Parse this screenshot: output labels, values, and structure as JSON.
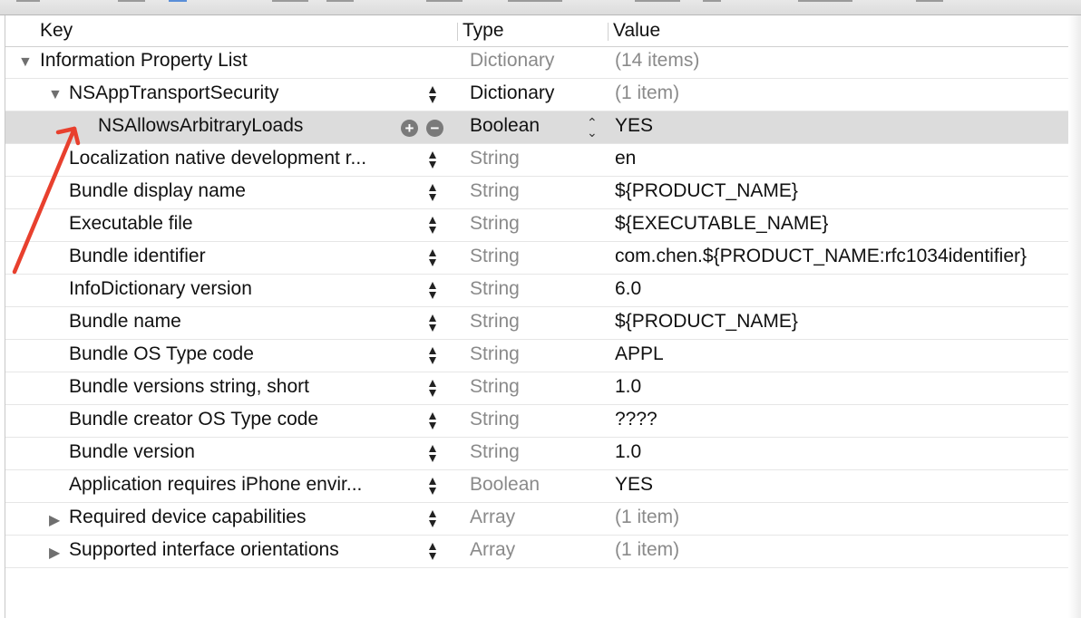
{
  "columns": {
    "key": "Key",
    "type": "Type",
    "value": "Value"
  },
  "rows": [
    {
      "key": "Information Property List",
      "type": "Dictionary",
      "value": "(14 items)"
    },
    {
      "key": "NSAppTransportSecurity",
      "type": "Dictionary",
      "value": "(1 item)"
    },
    {
      "key": "NSAllowsArbitraryLoads",
      "type": "Boolean",
      "value": "YES"
    },
    {
      "key": "Localization native development r...",
      "type": "String",
      "value": "en"
    },
    {
      "key": "Bundle display name",
      "type": "String",
      "value": "${PRODUCT_NAME}"
    },
    {
      "key": "Executable file",
      "type": "String",
      "value": "${EXECUTABLE_NAME}"
    },
    {
      "key": "Bundle identifier",
      "type": "String",
      "value": "com.chen.${PRODUCT_NAME:rfc1034identifier}"
    },
    {
      "key": "InfoDictionary version",
      "type": "String",
      "value": "6.0"
    },
    {
      "key": "Bundle name",
      "type": "String",
      "value": "${PRODUCT_NAME}"
    },
    {
      "key": "Bundle OS Type code",
      "type": "String",
      "value": "APPL"
    },
    {
      "key": "Bundle versions string, short",
      "type": "String",
      "value": "1.0"
    },
    {
      "key": "Bundle creator OS Type code",
      "type": "String",
      "value": "????"
    },
    {
      "key": "Bundle version",
      "type": "String",
      "value": "1.0"
    },
    {
      "key": "Application requires iPhone envir...",
      "type": "Boolean",
      "value": "YES"
    },
    {
      "key": "Required device capabilities",
      "type": "Array",
      "value": "(1 item)"
    },
    {
      "key": "Supported interface orientations",
      "type": "Array",
      "value": "(1 item)"
    }
  ],
  "icons": {
    "add": "+",
    "remove": "−",
    "expanded": "▼",
    "collapsed": "▶",
    "stepper": "⌃⌄"
  },
  "colors": {
    "annotation_arrow": "#e8402e",
    "selected_row": "#dcdcdc"
  }
}
